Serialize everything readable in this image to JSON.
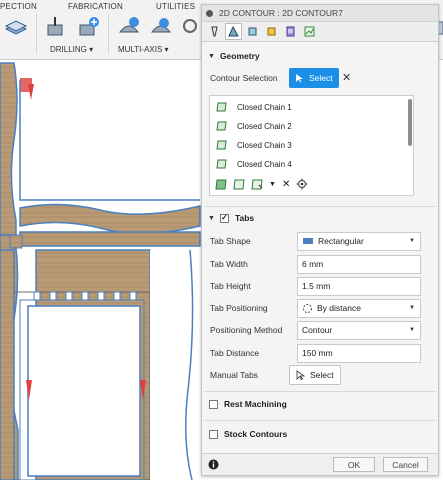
{
  "ribbon": {
    "tabs": [
      "PECTION",
      "FABRICATION",
      "UTILITIES"
    ],
    "groups": [
      {
        "label": "DRILLING ▾"
      },
      {
        "label": "MULTI-AXIS ▾"
      }
    ]
  },
  "dialog": {
    "title": "2D CONTOUR : 2D CONTOUR7",
    "tab_icons": [
      "tool-icon",
      "geometry-icon",
      "heights-icon",
      "passes-icon",
      "linking-icon",
      "summary-icon"
    ],
    "geometry": {
      "heading": "Geometry",
      "contour_selection_label": "Contour Selection",
      "select_button": "Select",
      "chains": [
        "Closed Chain 1",
        "Closed Chain 2",
        "Closed Chain 3",
        "Closed Chain 4"
      ]
    },
    "tabs_section": {
      "heading": "Tabs",
      "checked": true,
      "tab_shape": {
        "label": "Tab Shape",
        "value": "Rectangular"
      },
      "tab_width": {
        "label": "Tab Width",
        "value": "6 mm"
      },
      "tab_height": {
        "label": "Tab Height",
        "value": "1.5 mm"
      },
      "tab_positioning": {
        "label": "Tab Positioning",
        "value": "By distance"
      },
      "positioning_method": {
        "label": "Positioning Method",
        "value": "Contour"
      },
      "tab_distance": {
        "label": "Tab Distance",
        "value": "150 mm"
      },
      "manual_tabs": {
        "label": "Manual Tabs",
        "button": "Select"
      }
    },
    "rest_machining": {
      "label": "Rest Machining",
      "checked": false
    },
    "stock_contours": {
      "label": "Stock Contours",
      "checked": false
    },
    "footer": {
      "ok": "OK",
      "cancel": "Cancel"
    }
  },
  "colors": {
    "accent": "#1b8ee8",
    "wood": "#b89a74",
    "contour": "#4a7fc0",
    "arrow": "#e04040"
  }
}
